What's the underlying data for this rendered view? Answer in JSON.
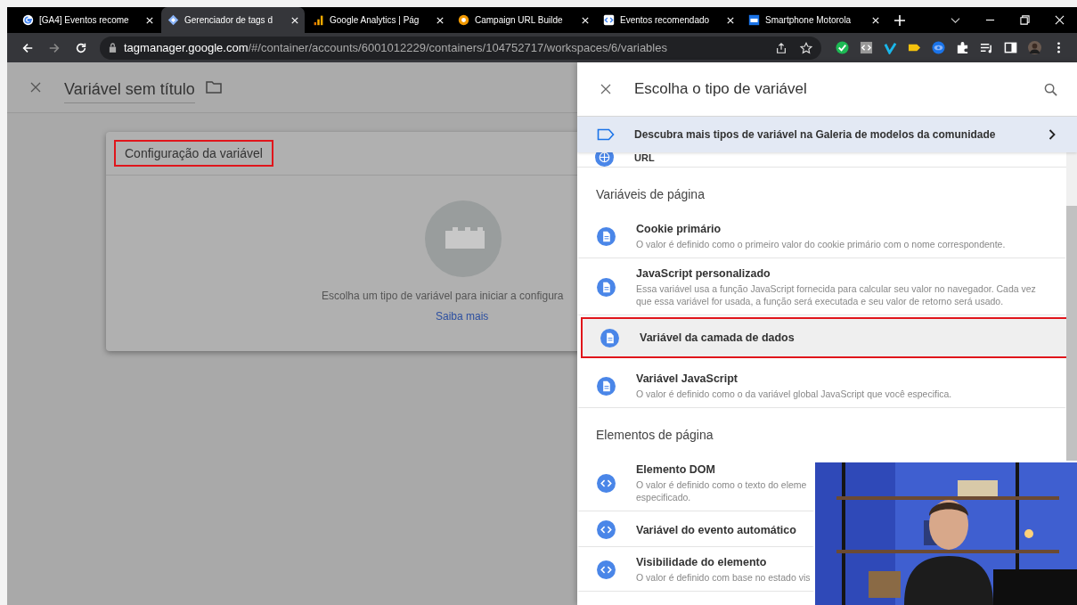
{
  "browser": {
    "tabs": [
      {
        "title": "[GA4] Eventos recome",
        "selected": false
      },
      {
        "title": "Gerenciador de tags d",
        "selected": true
      },
      {
        "title": "Google Analytics | Pág",
        "selected": false
      },
      {
        "title": "Campaign URL Builde",
        "selected": false
      },
      {
        "title": "Eventos recomendado",
        "selected": false
      },
      {
        "title": "Smartphone Motorola",
        "selected": false
      }
    ],
    "url_host": "tagmanager.google.com",
    "url_path": "/#/container/accounts/6001012229/containers/104752717/workspaces/6/variables"
  },
  "editor": {
    "title": "Variável sem título",
    "card_title": "Configuração da variável",
    "card_title_highlighted": true,
    "empty_text": "Escolha um tipo de variável para iniciar a configura",
    "link": "Saiba mais"
  },
  "panel": {
    "title": "Escolha o tipo de variável",
    "gallery": "Descubra mais tipos de variável na Galeria de modelos da comunidade",
    "cut_item": {
      "name": "URL"
    },
    "sections": [
      {
        "heading": "Variáveis de página",
        "items": [
          {
            "name": "Cookie primário",
            "description": "O valor é definido como o primeiro valor do cookie primário com o nome correspondente.",
            "kind": "document",
            "highlighted": false
          },
          {
            "name": "JavaScript personalizado",
            "description": "Essa variável usa a função JavaScript fornecida para calcular seu valor no navegador. Cada vez que essa variável for usada, a função será executada e seu valor de retorno será usado.",
            "kind": "document",
            "highlighted": false
          },
          {
            "name": "Variável da camada de dados",
            "kind": "document",
            "highlighted": true
          },
          {
            "name": "Variável JavaScript",
            "description": "O valor é definido como o da variável global JavaScript que você especifica.",
            "kind": "document",
            "highlighted": false
          }
        ]
      },
      {
        "heading": "Elementos de página",
        "items": [
          {
            "name": "Elemento DOM",
            "description": "O valor é definido como o texto do eleme\nespecificado.",
            "kind": "code",
            "highlighted": false
          },
          {
            "name": "Variável do evento automático",
            "kind": "code",
            "highlighted": false
          },
          {
            "name": "Visibilidade do elemento",
            "description": "O valor é definido com base no estado vis",
            "kind": "code",
            "highlighted": false
          }
        ]
      }
    ]
  }
}
